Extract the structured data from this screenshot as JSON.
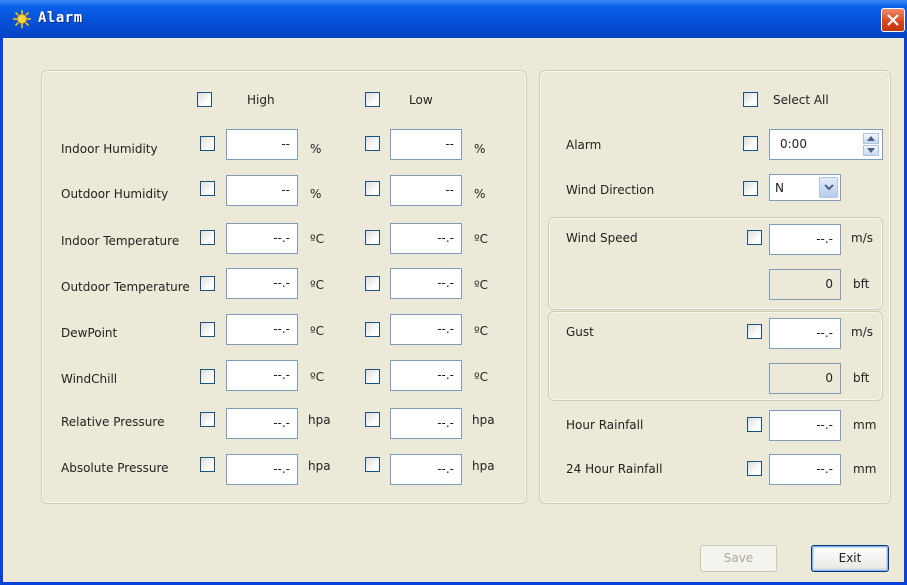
{
  "window": {
    "title": "Alarm"
  },
  "colors": {
    "title_bar": "#0550d6",
    "close": "#d8431c",
    "field_border": "#7f9db9",
    "face": "#ece9d8"
  },
  "icons": {
    "title": "sun-icon",
    "close": "close-icon"
  },
  "left": {
    "headers": {
      "high": "High",
      "low": "Low"
    },
    "rows": [
      {
        "label": "Indoor Humidity",
        "high_value": "--",
        "high_unit": "%",
        "low_value": "--",
        "low_unit": "%"
      },
      {
        "label": "Outdoor Humidity",
        "high_value": "--",
        "high_unit": "%",
        "low_value": "--",
        "low_unit": "%"
      },
      {
        "label": "Indoor Temperature",
        "high_value": "--.-",
        "high_unit": "ºC",
        "low_value": "--.-",
        "low_unit": "ºC"
      },
      {
        "label": "Outdoor Temperature",
        "high_value": "--.-",
        "high_unit": "ºC",
        "low_value": "--.-",
        "low_unit": "ºC"
      },
      {
        "label": "DewPoint",
        "high_value": "--.-",
        "high_unit": "ºC",
        "low_value": "--.-",
        "low_unit": "ºC"
      },
      {
        "label": "WindChill",
        "high_value": "--.-",
        "high_unit": "ºC",
        "low_value": "--.-",
        "low_unit": "ºC"
      },
      {
        "label": "Relative Pressure",
        "high_value": "--.-",
        "high_unit": "hpa",
        "low_value": "--.-",
        "low_unit": "hpa"
      },
      {
        "label": "Absolute Pressure",
        "high_value": "--.-",
        "high_unit": "hpa",
        "low_value": "--.-",
        "low_unit": "hpa"
      }
    ]
  },
  "right": {
    "select_all": "Select All",
    "alarm": {
      "label": "Alarm",
      "value": "0:00"
    },
    "wind_direction": {
      "label": "Wind Direction",
      "value": "N"
    },
    "wind_speed": {
      "label": "Wind Speed",
      "value": "--.-",
      "unit": "m/s",
      "bft_value": "0",
      "bft_unit": "bft"
    },
    "gust": {
      "label": "Gust",
      "value": "--.-",
      "unit": "m/s",
      "bft_value": "0",
      "bft_unit": "bft"
    },
    "hour_rainfall": {
      "label": "Hour Rainfall",
      "value": "--.-",
      "unit": "mm"
    },
    "day_rainfall": {
      "label": "24 Hour Rainfall",
      "value": "--.-",
      "unit": "mm"
    }
  },
  "buttons": {
    "save": "Save",
    "exit": "Exit"
  }
}
